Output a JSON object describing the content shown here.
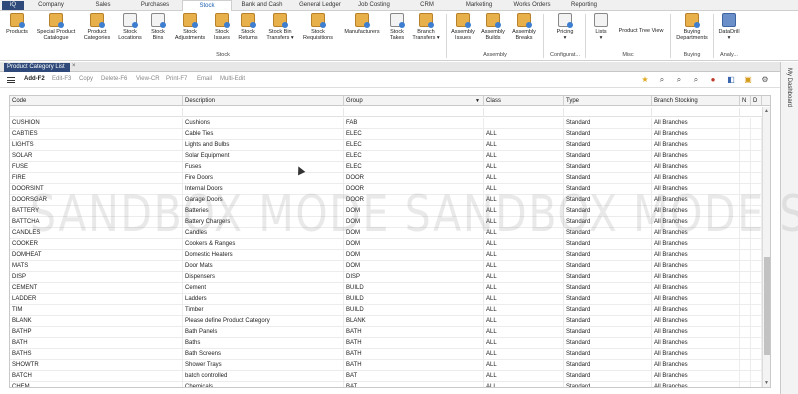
{
  "menubar": {
    "app": "iQ",
    "items": [
      "Company",
      "Sales",
      "Purchases",
      "Stock",
      "Bank and Cash",
      "General Ledger",
      "Job Costing",
      "CRM",
      "Marketing",
      "Works Orders",
      "Reporting"
    ],
    "active": "Stock"
  },
  "ribbon": {
    "buttons": [
      {
        "label": "Products"
      },
      {
        "label": "Special Product\nCatalogue"
      },
      {
        "label": "Product\nCategories"
      },
      {
        "label": "Stock\nLocations"
      },
      {
        "label": "Stock\nBins"
      },
      {
        "label": "Stock\nAdjustments"
      },
      {
        "label": "Stock\nIssues"
      },
      {
        "label": "Stock\nReturns"
      },
      {
        "label": "Stock Bin\nTransfers ▾"
      },
      {
        "label": "Stock\nRequisitions"
      },
      {
        "label": "Manufacturers"
      },
      {
        "label": "Stock\nTakes"
      },
      {
        "label": "Branch\nTransfers ▾"
      },
      {
        "label": "Assembly\nIssues"
      },
      {
        "label": "Assembly\nBuilds"
      },
      {
        "label": "Assembly\nBreaks"
      },
      {
        "label": "Pricing\n▾"
      },
      {
        "label": "Lists\n▾"
      },
      {
        "label": "Product Tree View"
      },
      {
        "label": "Buying\nDepartments"
      },
      {
        "label": "DataDrill\n▾"
      }
    ],
    "groups": [
      "Stock",
      "Assembly",
      "Configurat...",
      "Misc",
      "Buying",
      "Analy..."
    ]
  },
  "tab": {
    "title": "Product Category List",
    "close": "×"
  },
  "toolbar": {
    "items": [
      "Add-F2",
      "Edit-F3",
      "Copy",
      "Delete-F6",
      "View-CR",
      "Print-F7",
      "Email",
      "Multi-Edit"
    ]
  },
  "side_panel": "My Dashboard",
  "watermark": "SANDBOX MODE   SANDBOX MODE   SANDBOX MODE",
  "grid": {
    "columns": [
      "Code",
      "Description",
      "Group",
      "Class",
      "Type",
      "Branch Stocking",
      "N",
      "D"
    ],
    "rows": [
      [
        "CUSHION",
        "Cushions",
        "FAB",
        "",
        "Standard",
        "All Branches"
      ],
      [
        "CABTIES",
        "Cable Ties",
        "ELEC",
        "ALL",
        "Standard",
        "All Branches"
      ],
      [
        "LIGHTS",
        "Lights and Bulbs",
        "ELEC",
        "ALL",
        "Standard",
        "All Branches"
      ],
      [
        "SOLAR",
        "Solar Equipment",
        "ELEC",
        "ALL",
        "Standard",
        "All Branches"
      ],
      [
        "FUSE",
        "Fuses",
        "ELEC",
        "ALL",
        "Standard",
        "All Branches"
      ],
      [
        "FIRE",
        "Fire Doors",
        "DOOR",
        "ALL",
        "Standard",
        "All Branches"
      ],
      [
        "DOORSINT",
        "Internal Doors",
        "DOOR",
        "ALL",
        "Standard",
        "All Branches"
      ],
      [
        "DOORSGAR",
        "Garage Doors",
        "DOOR",
        "ALL",
        "Standard",
        "All Branches"
      ],
      [
        "BATTERY",
        "Batteries",
        "DOM",
        "ALL",
        "Standard",
        "All Branches"
      ],
      [
        "BATTCHA",
        "Battery Chargers",
        "DOM",
        "ALL",
        "Standard",
        "All Branches"
      ],
      [
        "CANDLES",
        "Candles",
        "DOM",
        "ALL",
        "Standard",
        "All Branches"
      ],
      [
        "COOKER",
        "Cookers & Ranges",
        "DOM",
        "ALL",
        "Standard",
        "All Branches"
      ],
      [
        "DOMHEAT",
        "Domestic Heaters",
        "DOM",
        "ALL",
        "Standard",
        "All Branches"
      ],
      [
        "MATS",
        "Door Mats",
        "DOM",
        "ALL",
        "Standard",
        "All Branches"
      ],
      [
        "DISP",
        "Dispensers",
        "DISP",
        "ALL",
        "Standard",
        "All Branches"
      ],
      [
        "CEMENT",
        "Cement",
        "BUILD",
        "ALL",
        "Standard",
        "All Branches"
      ],
      [
        "LADDER",
        "Ladders",
        "BUILD",
        "ALL",
        "Standard",
        "All Branches"
      ],
      [
        "TIM",
        "Timber",
        "BUILD",
        "ALL",
        "Standard",
        "All Branches"
      ],
      [
        "BLANK",
        "Please define Product Category",
        "BLANK",
        "ALL",
        "Standard",
        "All Branches"
      ],
      [
        "BATHP",
        "Bath Panels",
        "BATH",
        "ALL",
        "Standard",
        "All Branches"
      ],
      [
        "BATH",
        "Baths",
        "BATH",
        "ALL",
        "Standard",
        "All Branches"
      ],
      [
        "BATHS",
        "Bath Screens",
        "BATH",
        "ALL",
        "Standard",
        "All Branches"
      ],
      [
        "SHOWTR",
        "Shower Trays",
        "BATH",
        "ALL",
        "Standard",
        "All Branches"
      ],
      [
        "BATCH",
        "batch controlled",
        "BAT",
        "ALL",
        "Standard",
        "All Branches"
      ],
      [
        "CHEM",
        "Chemicals",
        "BAT",
        "ALL",
        "Standard",
        "All Branches"
      ]
    ]
  }
}
